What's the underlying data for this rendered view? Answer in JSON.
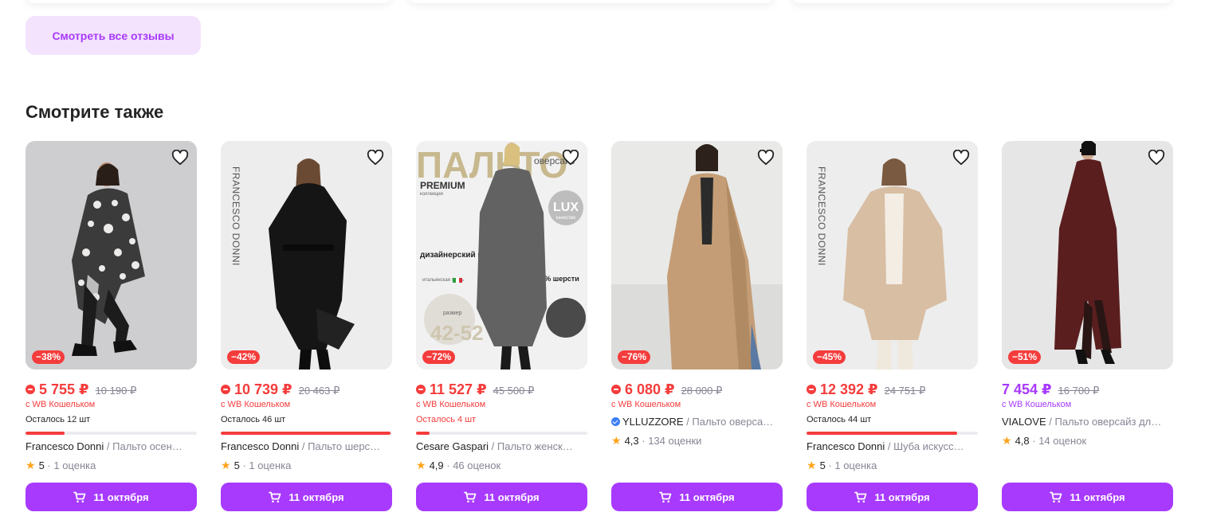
{
  "reviews_button": "Смотреть все отзывы",
  "section_title": "Смотрите также",
  "colors": {
    "accent": "#a73afd",
    "discount": "#f53c3c",
    "muted": "#868695",
    "star": "#ffa41b"
  },
  "products": [
    {
      "discount": "−38%",
      "price": "5 755 ₽",
      "old_price": "10 190 ₽",
      "wallet": "с WB Кошельком",
      "stock": "Осталось 12 шт",
      "stock_fill": 0.23,
      "brand": "Francesco Donni",
      "sep": " / ",
      "title": "Пальто осен…",
      "rating": "5",
      "reviews": "1 оценка",
      "delivery": "11 октября"
    },
    {
      "discount": "−42%",
      "price": "10 739 ₽",
      "old_price": "20 463 ₽",
      "wallet": "с WB Кошельком",
      "stock": "Осталось 46 шт",
      "stock_fill": 0.99,
      "brand": "Francesco Donni",
      "sep": " / ",
      "title": "Пальто шерс…",
      "rating": "5",
      "reviews": "1 оценка",
      "delivery": "11 октября",
      "photo_text": "FRANCESCO DONNI"
    },
    {
      "discount": "−72%",
      "price": "11 527 ₽",
      "old_price": "45 500 ₽",
      "wallet": "с WB Кошельком",
      "stock": "Осталось 4 шт",
      "stock_fill": 0.08,
      "brand": "Cesare Gaspari",
      "sep": " / ",
      "title": "Пальто женск…",
      "rating": "4,9",
      "reviews": "46 оценок",
      "delivery": "11 октября",
      "photo_text": {
        "big": "ПАЛЬТО",
        "oversize": "оверсайз",
        "premium": "PREMIUM",
        "collection": "коллекция",
        "lux": "LUX",
        "lux_sub": "качество",
        "design": "дизайнерский пошив",
        "fabric": "итальянская ткань",
        "wool": "70% шерсти",
        "size_label": "размер",
        "size": "42-52"
      }
    },
    {
      "discount": "−76%",
      "price": "6 080 ₽",
      "old_price": "28 000 ₽",
      "wallet": "с WB Кошельком",
      "brand": "YLLUZZORE",
      "sep": " / ",
      "title": "Пальто оверса…",
      "rating": "4,3",
      "reviews": "134 оценки",
      "delivery": "11 октября",
      "verified": true
    },
    {
      "discount": "−45%",
      "price": "12 392 ₽",
      "old_price": "24 751 ₽",
      "wallet": "с WB Кошельком",
      "stock": "Осталось 44 шт",
      "stock_fill": 0.88,
      "brand": "Francesco Donni",
      "sep": " / ",
      "title": "Шуба искусс…",
      "rating": "5",
      "reviews": "1 оценка",
      "delivery": "11 октября",
      "photo_text": "FRANCESCO DONNI"
    },
    {
      "discount": "−51%",
      "price": "7 454 ₽",
      "old_price": "16 700 ₽",
      "wallet": "с WB Кошельком",
      "brand": "VIALOVE",
      "sep": " / ",
      "title": "Пальто оверсайз дл…",
      "rating": "4,8",
      "reviews": "14 оценок",
      "delivery": "11 октября",
      "purple_price": true
    }
  ]
}
